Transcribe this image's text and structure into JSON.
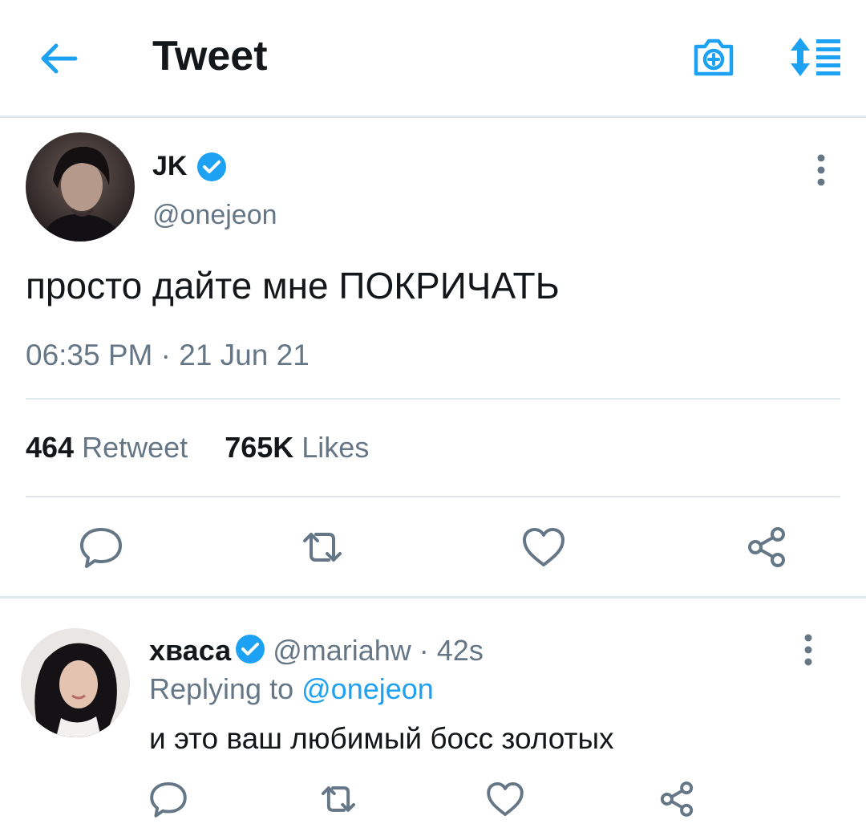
{
  "header": {
    "title": "Tweet",
    "back_icon": "arrow-left-icon",
    "camera_icon": "camera-add-icon",
    "sort_icon": "sort-list-icon",
    "accent_color": "#1da1f2"
  },
  "tweet": {
    "author_name": "JK",
    "author_handle": "@onejeon",
    "verified": true,
    "text": "просто дайте мне ПОКРИЧАТЬ",
    "timestamp": "06:35 PM · 21 Jun 21",
    "stats": {
      "retweets_count": "464",
      "retweets_label": "Retweet",
      "likes_count": "765K",
      "likes_label": "Likes"
    },
    "actions": [
      "reply-icon",
      "retweet-icon",
      "like-icon",
      "share-icon"
    ]
  },
  "reply": {
    "author_name": "хваса",
    "author_handle": "@mariahw",
    "time_ago": "· 42s",
    "verified": true,
    "replying_prefix": "Replying to",
    "replying_mention": "@onejeon",
    "text": "и это ваш любимый босс золотых",
    "actions": [
      "reply-icon",
      "retweet-icon",
      "like-icon",
      "share-icon"
    ]
  }
}
